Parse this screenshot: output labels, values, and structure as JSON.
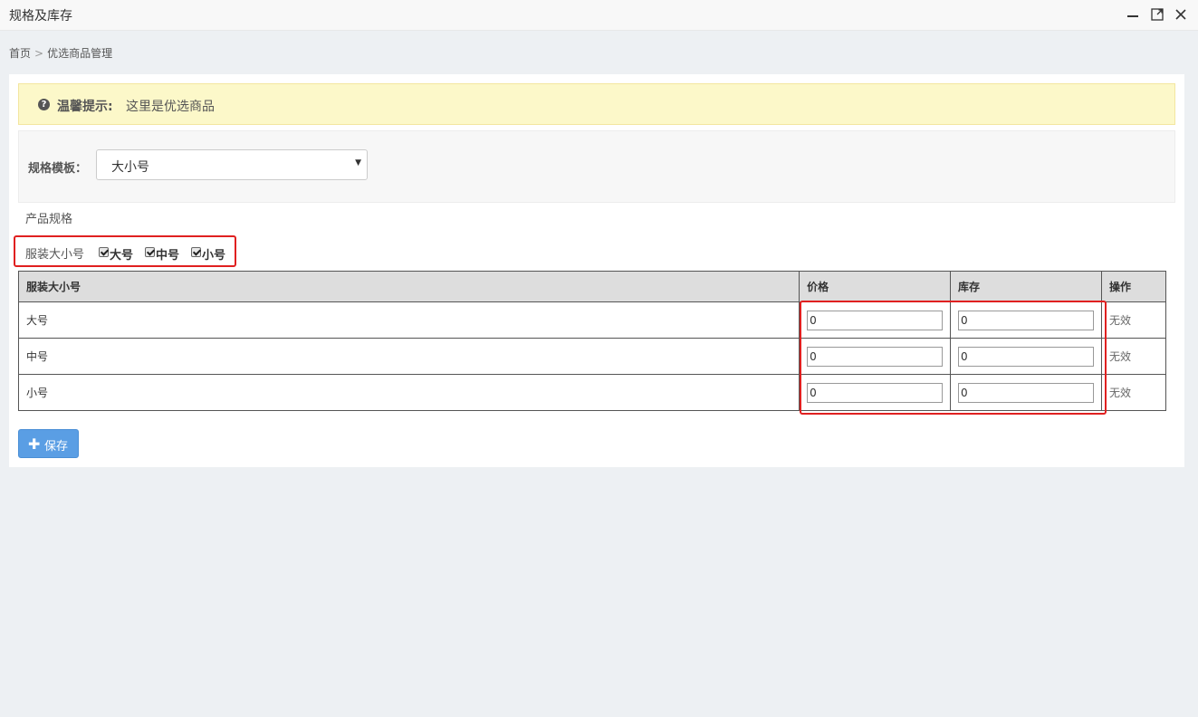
{
  "window": {
    "title": "规格及库存",
    "minimize_icon": "minimize-icon",
    "maximize_icon": "maximize-icon",
    "close_icon": "close-icon"
  },
  "breadcrumb": {
    "home": "首页",
    "separator": ">",
    "current": "优选商品管理"
  },
  "tip": {
    "icon": "question-circle-icon",
    "label": "温馨提示:",
    "text": "这里是优选商品"
  },
  "template": {
    "label": "规格模板：",
    "selected": "大小号"
  },
  "spec_title": "产品规格",
  "spec_group": {
    "label": "服装大小号",
    "options": [
      {
        "label": "大号",
        "checked": true
      },
      {
        "label": "中号",
        "checked": true
      },
      {
        "label": "小号",
        "checked": true
      }
    ]
  },
  "table": {
    "headers": [
      "服装大小号",
      "价格",
      "库存",
      "操作"
    ],
    "rows": [
      {
        "name": "大号",
        "price": "0",
        "stock": "0",
        "action": "无效"
      },
      {
        "name": "中号",
        "price": "0",
        "stock": "0",
        "action": "无效"
      },
      {
        "name": "小号",
        "price": "0",
        "stock": "0",
        "action": "无效"
      }
    ]
  },
  "save_button": {
    "icon": "plus-icon",
    "label": "保存"
  },
  "colors": {
    "tip_bg": "#fcf8c9",
    "button_blue": "#5a9ee4",
    "highlight_red": "#e02020"
  }
}
